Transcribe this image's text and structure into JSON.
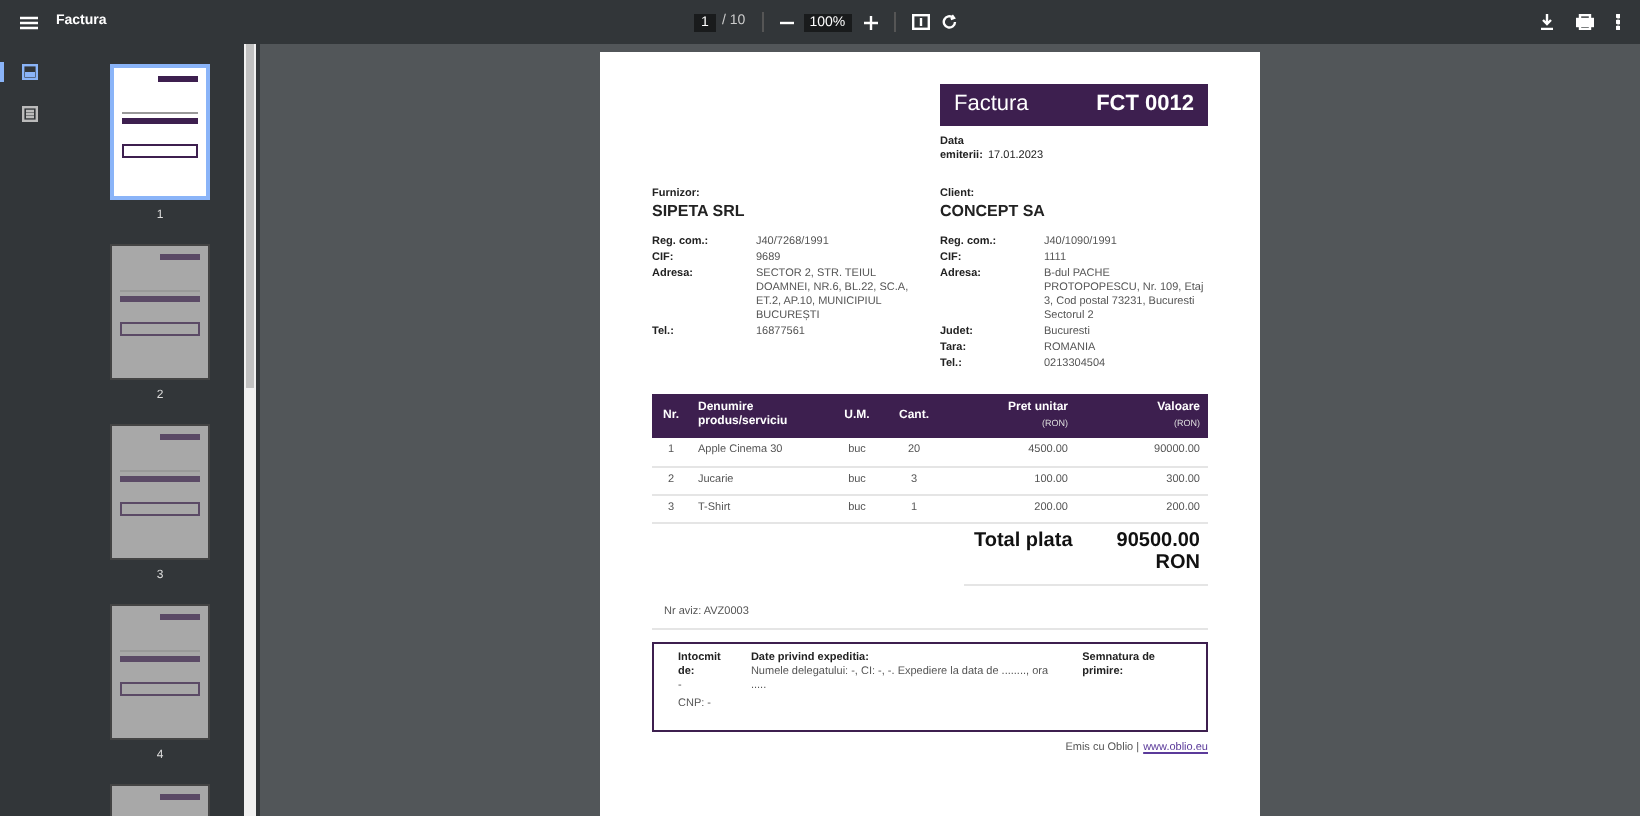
{
  "toolbar": {
    "title": "Factura",
    "page_input": "1",
    "page_count": "/ 10",
    "zoom": "100%"
  },
  "sidebar": {
    "views": [
      {
        "kind": "thumbnails",
        "selected": true
      },
      {
        "kind": "outline",
        "selected": false
      }
    ]
  },
  "thumbnails": [
    {
      "label": "1",
      "selected": true
    },
    {
      "label": "2",
      "selected": false
    },
    {
      "label": "3",
      "selected": false
    },
    {
      "label": "4",
      "selected": false
    },
    {
      "selected": false
    }
  ],
  "invoice": {
    "title": "Factura",
    "number": "FCT 0012",
    "date_label": "Data emiterii:",
    "date": "17.01.2023",
    "supplier": {
      "label": "Furnizor:",
      "name": "SIPETA SRL",
      "fields": [
        {
          "label": "Reg. com.:",
          "value": "J40/7268/1991"
        },
        {
          "label": "CIF:",
          "value": "9689"
        },
        {
          "label": "Adresa:",
          "value": "SECTOR 2, STR. TEIUL DOAMNEI, NR.6, BL.22, SC.A, ET.2, AP.10, MUNICIPIUL BUCUREȘTI"
        },
        {
          "label": "Tel.:",
          "value": "16877561"
        }
      ]
    },
    "client": {
      "label": "Client:",
      "name": "CONCEPT SA",
      "fields": [
        {
          "label": "Reg. com.:",
          "value": "J40/1090/1991"
        },
        {
          "label": "CIF:",
          "value": "1111"
        },
        {
          "label": "Adresa:",
          "value": "B-dul PACHE PROTOPOPESCU, Nr. 109, Etaj 3, Cod postal 73231, Bucuresti Sectorul 2"
        },
        {
          "label": "Judet:",
          "value": "Bucuresti"
        },
        {
          "label": "Tara:",
          "value": "ROMANIA"
        },
        {
          "label": "Tel.:",
          "value": "0213304504"
        }
      ]
    },
    "table": {
      "columns": [
        {
          "label": "Nr."
        },
        {
          "label": "Denumire produs/serviciu"
        },
        {
          "label": "U.M."
        },
        {
          "label": "Cant."
        },
        {
          "label": "Pret unitar",
          "unit": "(RON)"
        },
        {
          "label": "Valoare",
          "unit": "(RON)"
        }
      ],
      "rows": [
        [
          "1",
          "Apple Cinema 30",
          "buc",
          "20",
          "4500.00",
          "90000.00"
        ],
        [
          "2",
          "Jucarie",
          "buc",
          "3",
          "100.00",
          "300.00"
        ],
        [
          "3",
          "T-Shirt",
          "buc",
          "1",
          "200.00",
          "200.00"
        ]
      ]
    },
    "total_label": "Total plata",
    "total_value": "90500.00 RON",
    "aviz": "Nr aviz: AVZ0003",
    "shipping": {
      "prepared_label": "Intocmit de:",
      "prepared_by": "-",
      "cnp": "CNP: -",
      "details_label": "Date privind expeditia:",
      "details": "Numele delegatului: -, CI: -, -. Expediere la data de ........, ora .....",
      "signature_label": "Semnatura de primire:"
    },
    "credit": "Emis cu Oblio |",
    "credit_link": "www.oblio.eu"
  }
}
